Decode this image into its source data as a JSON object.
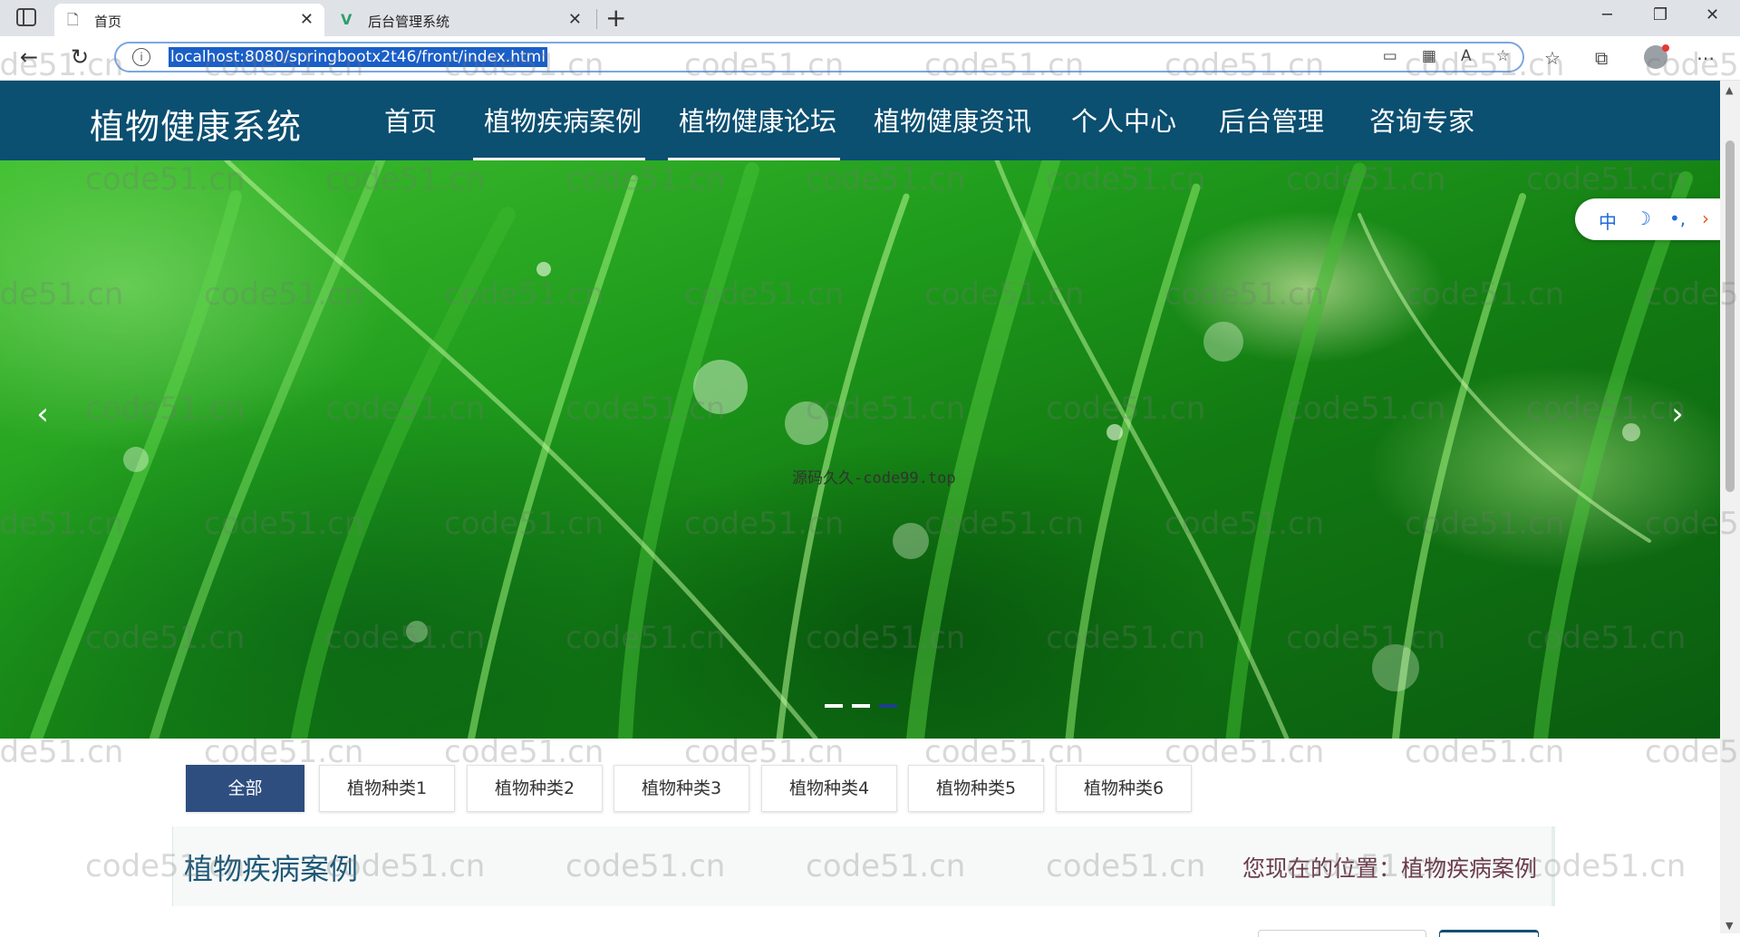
{
  "browser": {
    "tabs": [
      {
        "title": "首页",
        "icon": "page-icon",
        "active": true
      },
      {
        "title": "后台管理系统",
        "icon": "vue-logo-icon",
        "active": false
      }
    ],
    "address": "localhost:8080/springbootx2t46/front/index.html",
    "window_controls": {
      "minimize": "─",
      "maximize": "❐",
      "close": "✕"
    }
  },
  "site": {
    "title": "植物健康系统",
    "nav": [
      "首页",
      "植物疾病案例",
      "植物健康论坛",
      "植物健康资讯",
      "个人中心",
      "后台管理",
      "咨询专家"
    ],
    "active_nav_index": 1,
    "hover_nav_index": 2
  },
  "carousel": {
    "caption": "源码久久-code99.top",
    "slides_count": 3,
    "active_slide": 2,
    "prev_glyph": "‹",
    "next_glyph": "›"
  },
  "float_tools": {
    "lang": "中",
    "moon": "☽",
    "dots": "•,",
    "arrow": "›"
  },
  "categories": [
    "全部",
    "植物种类1",
    "植物种类2",
    "植物种类3",
    "植物种类4",
    "植物种类5",
    "植物种类6"
  ],
  "active_category": 0,
  "panel": {
    "title": "植物疾病案例",
    "breadcrumb": "您现在的位置：植物疾病案例"
  },
  "watermark_text": "code51.cn",
  "colors": {
    "header_bg": "#0b4f71",
    "active_category_bg": "#2e4e80",
    "panel_title": "#1f5878",
    "breadcrumb": "#6b3a4b"
  }
}
